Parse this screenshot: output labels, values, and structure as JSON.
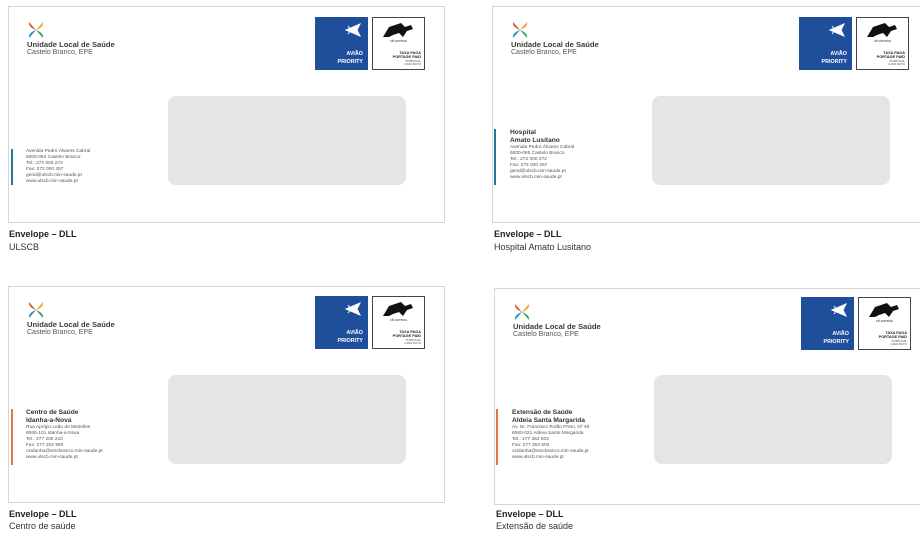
{
  "org": {
    "name": "Unidade Local de Saúde",
    "sub": "Castelo Branco, EPE"
  },
  "stamp": {
    "line1": "AVIÃO",
    "line2": "PRIORITY",
    "ctt": "ctt correios",
    "paid1": "TAXA PAGA",
    "paid2": "PORTAGE PAID",
    "small1": "PORTUGAL",
    "small2": "CASO DUTO"
  },
  "colors": {
    "blue": "#1f4e9b",
    "teal": "#1f7a9a",
    "orange": "#e07a3a",
    "window": "#e5e5e5"
  },
  "envelopes": [
    {
      "caption_title": "Envelope – DLL",
      "caption_sub": "ULSCB",
      "heading1": "",
      "heading2": "",
      "lines": [
        "Avenida Pedro Álvares Cabral",
        "6000-084 Castelo Branco",
        "Tel.: 272 000 272",
        "Fax: 272 000 257",
        "geral@ulscb.min-saude.pt",
        "www.ulscb.min-saude.pt"
      ]
    },
    {
      "caption_title": "Envelope – DLL",
      "caption_sub": "Hospital Amato Lusitano",
      "heading1": "Hospital",
      "heading2": "Amato Lusitano",
      "lines": [
        "Avenida Pedro Álvares Cabral",
        "6000-085 Castelo Branco",
        "Tel.: 272 000 272",
        "Fax: 272 000 257",
        "geral@ulscb.min-saude.pt",
        "www.ulscb.min-saude.pt"
      ]
    },
    {
      "caption_title": "Envelope – DLL",
      "caption_sub": "Centro de saúde",
      "heading1": "Centro de Saúde",
      "heading2": "Idanha-a-Nova",
      "lines": [
        "Rua Aprígio Leão de Meirelles",
        "6060-101 Idanha-a-Nova",
        "Tel.: 277 200 210",
        "Fax: 277 202 983",
        "csidanha@srscbranco.min-saude.pt",
        "www.ulscb.min-saude.pt"
      ]
    },
    {
      "caption_title": "Envelope – DLL",
      "caption_sub": "Extensão de saúde",
      "heading1": "Extensão de Saúde",
      "heading2": "Aldeia Santa Margarida",
      "lines": [
        "Av. Dr. Francisco Rolão Preto, Nº 46",
        "6060-021 Aldeia Santa Margarida",
        "Tel.: 277 353 503",
        "Fax: 277 353 503",
        "csidanha@srscbranco.min-saude.pt",
        "www.ulscb.min-saude.pt"
      ]
    }
  ]
}
